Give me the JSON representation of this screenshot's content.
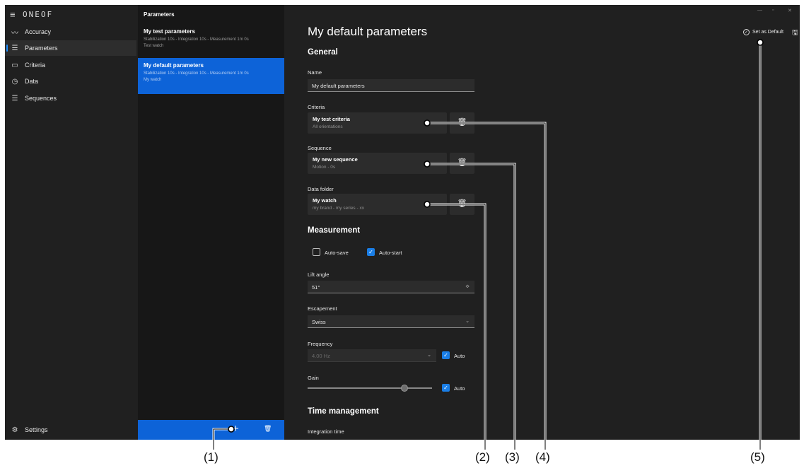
{
  "app": {
    "brand": "ONEOF"
  },
  "nav": {
    "items": [
      {
        "label": "Accuracy",
        "icon": "accuracy-icon",
        "glyph": "〰"
      },
      {
        "label": "Parameters",
        "icon": "sliders-icon",
        "glyph": "☰"
      },
      {
        "label": "Criteria",
        "icon": "monitor-icon",
        "glyph": "▭"
      },
      {
        "label": "Data",
        "icon": "clock-icon",
        "glyph": "◷"
      },
      {
        "label": "Sequences",
        "icon": "list-icon",
        "glyph": "☰"
      }
    ],
    "settings_label": "Settings"
  },
  "list": {
    "title": "Parameters",
    "items": [
      {
        "title": "My test parameters",
        "line1": "Stabilization 10s - Integration 10s - Measurement 1m 0s",
        "line2": "Test watch"
      },
      {
        "title": "My default parameters",
        "line1": "Stabilization 10s - Integration 10s - Measurement 1m 0s",
        "line2": "My watch"
      }
    ],
    "add_symbol": "+",
    "delete_symbol": "🗑"
  },
  "detail": {
    "title": "My default parameters",
    "set_default_label": "Set as Default",
    "general": {
      "heading": "General",
      "name_label": "Name",
      "name_value": "My default parameters",
      "criteria_label": "Criteria",
      "criteria_title": "My test criteria",
      "criteria_sub": "All orientations",
      "sequence_label": "Sequence",
      "sequence_title": "My new sequence",
      "sequence_sub": "Motion - 0s",
      "data_label": "Data folder",
      "data_title": "My watch",
      "data_sub": "my brand - my series - xx",
      "dots": "....."
    },
    "measurement": {
      "heading": "Measurement",
      "autosave_label": "Auto-save",
      "autosave_checked": false,
      "autostart_label": "Auto-start",
      "autostart_checked": true,
      "lift_label": "Lift angle",
      "lift_value": "51°",
      "escapement_label": "Escapement",
      "escapement_value": "Swiss",
      "frequency_label": "Frequency",
      "frequency_value": "4.00 Hz",
      "frequency_auto_label": "Auto",
      "gain_label": "Gain",
      "gain_auto_label": "Auto",
      "gain_level": 0.78
    },
    "time": {
      "heading": "Time management",
      "integration_label": "Integration time"
    }
  },
  "callouts": [
    "(1)",
    "(2)",
    "(3)",
    "(4)",
    "(5)"
  ],
  "colors": {
    "accent": "#0d63d8",
    "check": "#1a7ee6",
    "background": "#202020"
  }
}
